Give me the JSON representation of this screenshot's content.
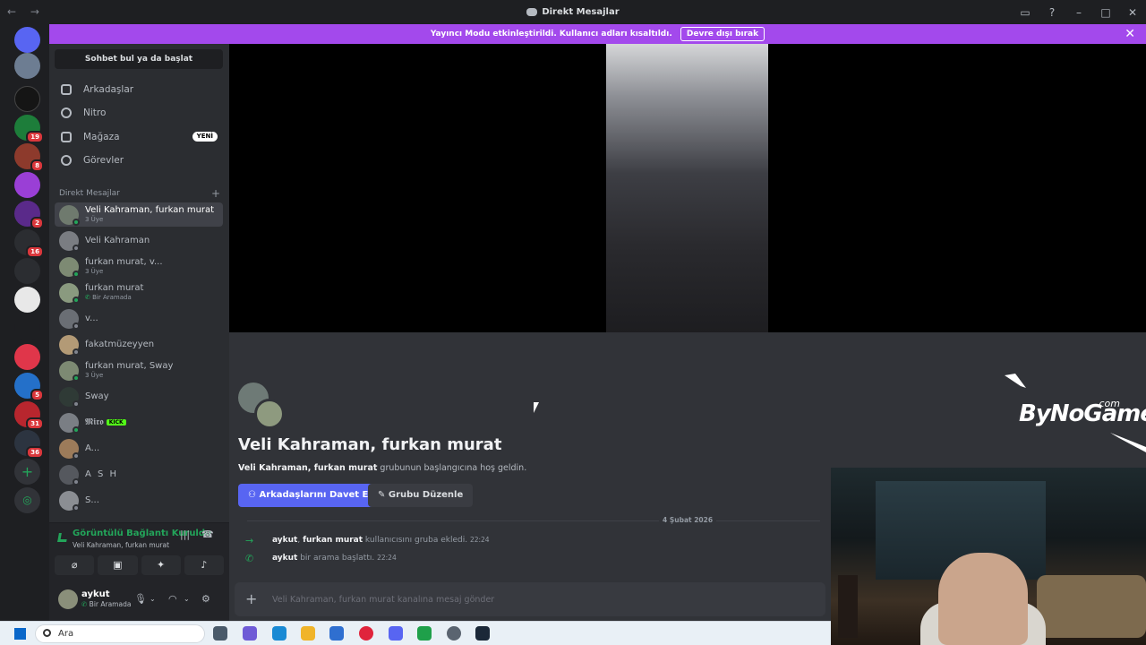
{
  "window": {
    "title": "Direkt Mesajlar",
    "nav": "← →"
  },
  "banner": {
    "message": "Yayıncı Modu etkinleştirildi. Kullanıcı adları kısaltıldı.",
    "button": "Devre dışı bırak"
  },
  "servers": [
    {
      "badge": ""
    },
    {
      "badge": ""
    },
    {
      "badge": ""
    },
    {
      "badge": "19"
    },
    {
      "badge": "8"
    },
    {
      "badge": ""
    },
    {
      "badge": "2"
    },
    {
      "badge": "16"
    },
    {
      "badge": ""
    },
    {
      "badge": ""
    },
    {
      "badge": ""
    },
    {
      "badge": ""
    },
    {
      "badge": "5"
    },
    {
      "badge": "31"
    },
    {
      "badge": "36"
    }
  ],
  "sidebar": {
    "search_button": "Sohbet bul ya da başlat",
    "nav": [
      {
        "label": "Arkadaşlar",
        "icon": "friends-icon"
      },
      {
        "label": "Nitro",
        "icon": "nitro-icon"
      },
      {
        "label": "Mağaza",
        "icon": "shop-icon",
        "badge": "YENİ"
      },
      {
        "label": "Görevler",
        "icon": "quests-icon"
      }
    ],
    "dm_header": "Direkt Mesajlar",
    "dms": [
      {
        "name": "Veli Kahraman, furkan murat",
        "sub": "3 Üye",
        "active": true
      },
      {
        "name": "Veli Kahraman",
        "sub": ""
      },
      {
        "name": "furkan murat, v...",
        "sub": "3 Üye"
      },
      {
        "name": "furkan murat",
        "sub": "Bir Aramada"
      },
      {
        "name": "v...",
        "sub": ""
      },
      {
        "name": "fakatmüzeyyen",
        "sub": ""
      },
      {
        "name": "furkan murat, Sway",
        "sub": "3 Üye"
      },
      {
        "name": "Sway",
        "sub": ""
      },
      {
        "name": "𝕸𝖎𝖗𝖔",
        "sub": "",
        "tag": "KICK"
      },
      {
        "name": "A...",
        "sub": ""
      },
      {
        "name": "A S H",
        "sub": ""
      },
      {
        "name": "S...",
        "sub": ""
      }
    ]
  },
  "voice": {
    "status": "Görüntülü Bağlantı Kuruldu",
    "channel": "Veli Kahraman, furkan murat"
  },
  "user": {
    "name": "aykut",
    "status": "Bir Aramada"
  },
  "chat": {
    "group_title": "Veli Kahraman, furkan murat",
    "welcome_name": "Veli Kahraman, furkan murat",
    "welcome_rest": " grubunun başlangıcına hoş geldin.",
    "invite_button": "Arkadaşlarını Davet Et",
    "edit_button": "Grubu Düzenle",
    "date": "4 Şubat 2026",
    "messages": [
      {
        "actor": "aykut",
        "target": "furkan murat",
        "text": " kullanıcısını gruba ekledi.",
        "time": "22:24"
      },
      {
        "actor": "aykut",
        "text": " bir arama başlattı.",
        "time": "22:24"
      }
    ],
    "composer_placeholder": "Veli Kahraman, furkan murat kanalına mesaj gönder"
  },
  "overlay": {
    "logo_text": "ByNoGame",
    "logo_suffix": ".com"
  },
  "taskbar": {
    "search_label": "Ara"
  }
}
